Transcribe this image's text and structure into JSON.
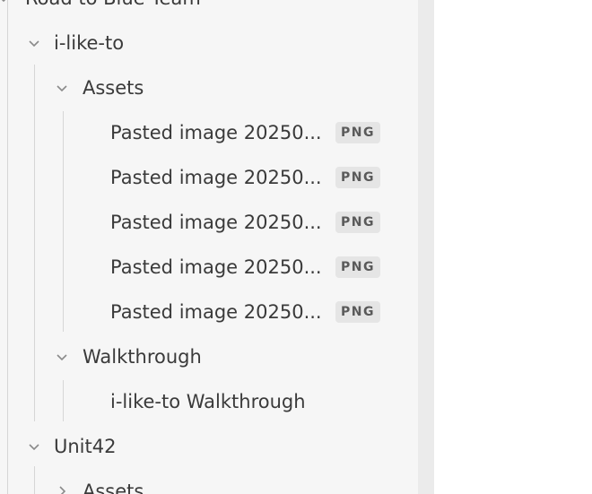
{
  "tree": {
    "root_partial_label": "Road to Blue Team",
    "folder_ilike": "i-like-to",
    "assets_1": "Assets",
    "pasted_files": [
      {
        "name": "Pasted image 20250...",
        "ext": "PNG"
      },
      {
        "name": "Pasted image 20250...",
        "ext": "PNG"
      },
      {
        "name": "Pasted image 20250...",
        "ext": "PNG"
      },
      {
        "name": "Pasted image 20250...",
        "ext": "PNG"
      },
      {
        "name": "Pasted image 20250...",
        "ext": "PNG"
      }
    ],
    "walkthrough_folder": "Walkthrough",
    "walkthrough_file": "i-like-to Walkthrough",
    "folder_unit42": "Unit42",
    "assets_2": "Assets"
  },
  "icons": {
    "expanded": "chevron-down-icon",
    "collapsed": "chevron-right-icon"
  },
  "colors": {
    "sidebar_bg": "#f6f6f6",
    "text": "#3a3a3a",
    "badge_bg": "#e5e5e5"
  }
}
